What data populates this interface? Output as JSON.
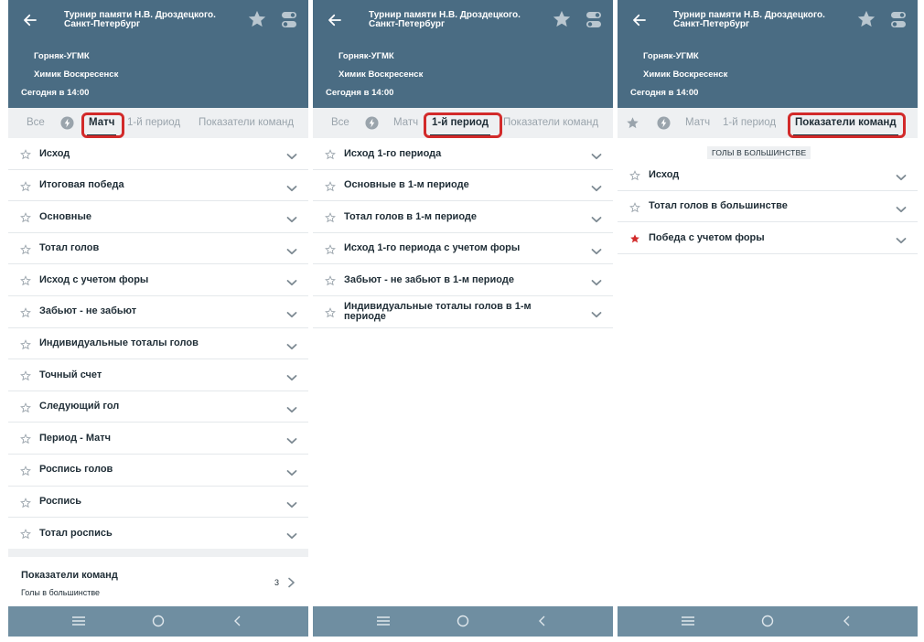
{
  "header": {
    "title_line1": "Турнир памяти Н.В. Дроздецкого.",
    "title_line2": "Санкт-Петербург",
    "team1": "Горняк-УГМК",
    "team2": "Химик Воскресенск",
    "time": "Сегодня в 14:00"
  },
  "tabs": {
    "all": "Все",
    "match": "Матч",
    "period1": "1-й период",
    "team_stats": "Показатели команд"
  },
  "colors": {
    "header_bg": "#4a6c83",
    "highlight": "#d22a2a",
    "navbar_bg": "#6f8ea1"
  },
  "screens": [
    {
      "active_tab": "match",
      "markets": [
        "Исход",
        "Итоговая победа",
        "Основные",
        "Тотал голов",
        "Исход с учетом форы",
        "Забьют - не забьют",
        "Индивидуальные тоталы голов",
        "Точный счет",
        "Следующий гол",
        "Период - Матч",
        "Роспись голов",
        "Роспись",
        "Тотал роспись"
      ],
      "team_stats_block": {
        "title": "Показатели команд",
        "subtitle": "Голы в большинстве",
        "count": "3"
      }
    },
    {
      "active_tab": "period1",
      "markets": [
        "Исход 1-го периода",
        "Основные в 1-м периоде",
        "Тотал голов в 1-м периоде",
        "Исход 1-го периода с учетом форы",
        "Забьют - не забьют в 1-м периоде",
        "Индивидуальные тоталы голов в 1-м периоде"
      ]
    },
    {
      "active_tab": "team_stats",
      "section": "ГОЛЫ В БОЛЬШИНСТВЕ",
      "markets": [
        "Исход",
        "Тотал голов в большинстве",
        "Победа с учетом форы"
      ]
    }
  ],
  "icons": {
    "back": "arrow-left-icon",
    "favorite": "star-icon",
    "settings": "toggle-switch-icon",
    "live": "bolt-icon",
    "expand": "chevron-down-icon",
    "nav_menu": "menu-icon",
    "nav_home": "home-circle-icon",
    "nav_back": "back-triangle-icon"
  }
}
